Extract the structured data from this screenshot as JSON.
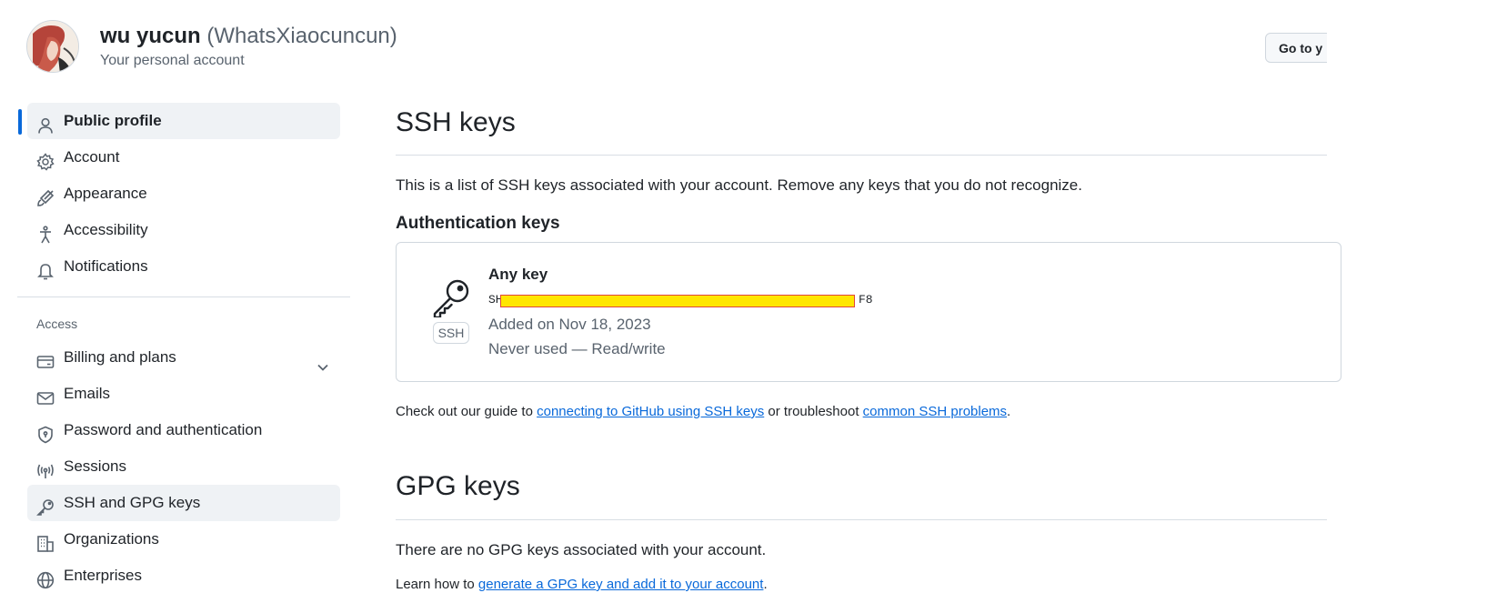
{
  "header": {
    "display_name": "wu yucun",
    "login": "(WhatsXiaocuncun)",
    "subtitle": "Your personal account",
    "goto_label": "Go to y"
  },
  "sidebar": {
    "items": [
      {
        "label": "Public profile",
        "icon": "person-icon"
      },
      {
        "label": "Account",
        "icon": "gear-icon"
      },
      {
        "label": "Appearance",
        "icon": "paintbrush-icon"
      },
      {
        "label": "Accessibility",
        "icon": "accessibility-icon"
      },
      {
        "label": "Notifications",
        "icon": "bell-icon"
      }
    ],
    "access_heading": "Access",
    "access_items": [
      {
        "label": "Billing and plans",
        "icon": "credit-card-icon"
      },
      {
        "label": "Emails",
        "icon": "mail-icon"
      },
      {
        "label": "Password and authentication",
        "icon": "shield-lock-icon"
      },
      {
        "label": "Sessions",
        "icon": "broadcast-icon"
      },
      {
        "label": "SSH and GPG keys",
        "icon": "key-icon"
      },
      {
        "label": "Organizations",
        "icon": "organization-icon"
      },
      {
        "label": "Enterprises",
        "icon": "globe-icon"
      }
    ]
  },
  "ssh": {
    "title": "SSH keys",
    "description": "This is a list of SSH keys associated with your account. Remove any keys that you do not recognize.",
    "auth_heading": "Authentication keys",
    "key": {
      "title": "Any key",
      "fingerprint_start": "SH",
      "fingerprint_end": "F8",
      "added": "Added on Nov 18, 2023",
      "usage": "Never used — Read/write",
      "badge": "SSH"
    },
    "guide_prefix": "Check out our guide to ",
    "guide_link": "connecting to GitHub using SSH keys",
    "guide_middle": " or troubleshoot ",
    "guide_link2": "common SSH problems",
    "guide_suffix": "."
  },
  "gpg": {
    "title": "GPG keys",
    "empty": "There are no GPG keys associated with your account.",
    "learn_prefix": "Learn how to ",
    "learn_link": "generate a GPG key and add it to your account",
    "learn_suffix": "."
  },
  "colors": {
    "accent": "#0969da",
    "muted": "#59636e",
    "border": "#d0d7de",
    "redaction": "#ffe600"
  }
}
